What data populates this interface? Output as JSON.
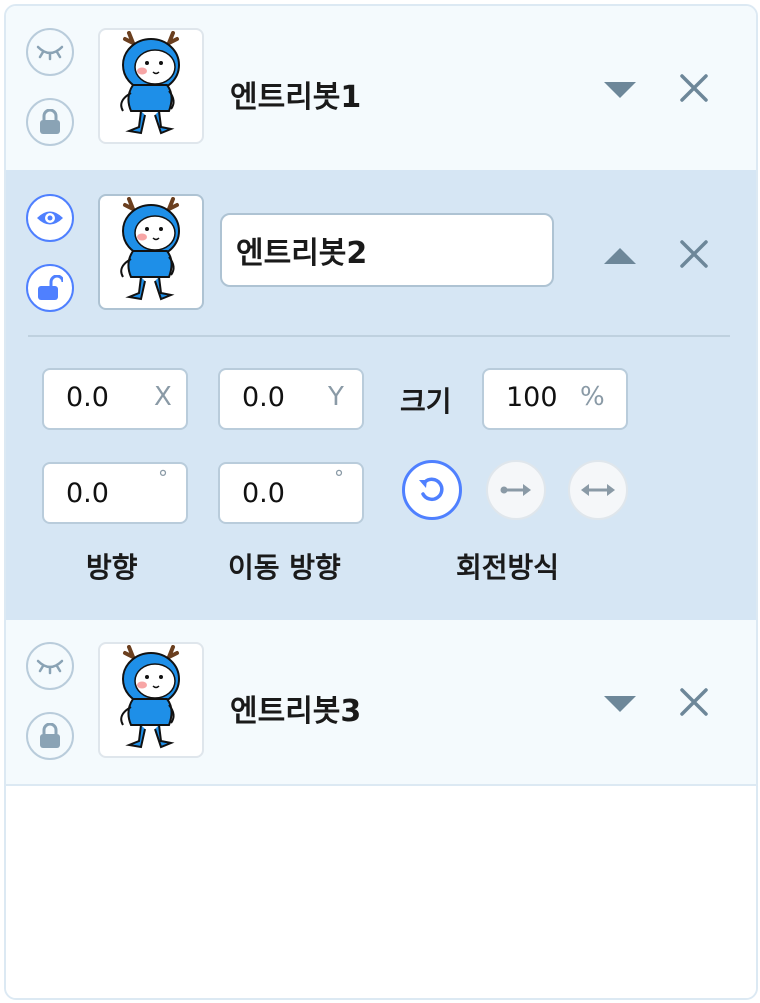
{
  "objects": [
    {
      "name": "엔트리봇1",
      "visibility_icon": "eye-closed-icon",
      "lock_icon": "lock-closed-icon",
      "expand_icon": "triangle-down-icon",
      "delete_icon": "close-icon",
      "expanded": false
    },
    {
      "name": "엔트리봇2",
      "visibility_icon": "eye-open-icon",
      "lock_icon": "lock-open-icon",
      "expand_icon": "triangle-up-icon",
      "delete_icon": "close-icon",
      "expanded": true,
      "properties": {
        "x": {
          "value": "0.0",
          "unit": "X"
        },
        "y": {
          "value": "0.0",
          "unit": "Y"
        },
        "size": {
          "label": "크기",
          "value": "100",
          "unit": "%"
        },
        "direction": {
          "value": "0.0",
          "unit": "°",
          "label": "방향"
        },
        "move_direction": {
          "value": "0.0",
          "unit": "°",
          "label": "이동 방향"
        },
        "rotation": {
          "label": "회전방식",
          "options": [
            "rotate-free-icon",
            "horizontal-only-icon",
            "no-rotate-icon"
          ],
          "selected": "rotate-free-icon"
        }
      }
    },
    {
      "name": "엔트리봇3",
      "visibility_icon": "eye-closed-icon",
      "lock_icon": "lock-closed-icon",
      "expand_icon": "triangle-down-icon",
      "delete_icon": "close-icon",
      "expanded": false
    }
  ],
  "colors": {
    "accent": "#4f80ff",
    "selected_row_bg": "#d6e6f4",
    "row_bg": "#f4fafd",
    "icon_gray": "#6d8799",
    "mascot_blue": "#1e8fe8"
  }
}
